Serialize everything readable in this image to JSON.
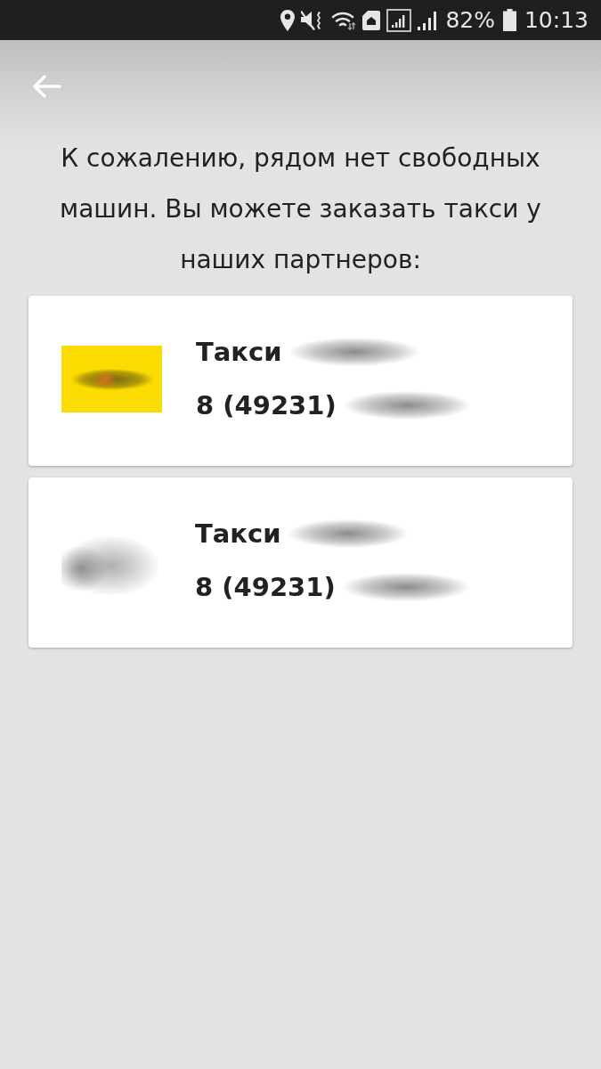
{
  "status_bar": {
    "battery_percent": "82%",
    "time": "10:13"
  },
  "message": "К сожалению, рядом нет свободных машин. Вы можете заказать такси у наших партнеров:",
  "partners": [
    {
      "kind": "tile",
      "name": "Такси",
      "phone": "8 (49231)"
    },
    {
      "kind": "smudge",
      "name": "Такси",
      "phone": "8 (49231)"
    }
  ]
}
